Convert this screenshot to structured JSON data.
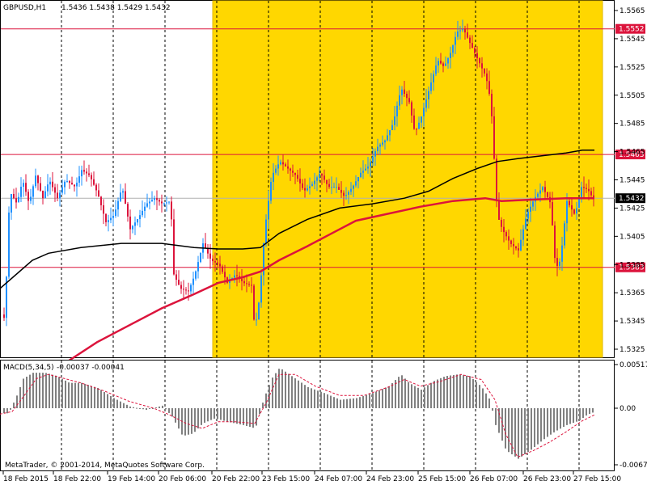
{
  "header": {
    "symbol": "GBPUSD,H1",
    "quote": "1.5436 1.5438 1.5429 1.5432"
  },
  "macd": {
    "label": "MACD(5,34,5)",
    "values": "-0.00037 -0.00041",
    "axis_labels": [
      "0.00517",
      "0.00",
      "-0.00671"
    ],
    "ylim": [
      -0.00671,
      0.00517
    ]
  },
  "footer": {
    "copyright": "MetaTrader, © 2001-2014, MetaQuotes Software Corp."
  },
  "colors": {
    "background": "#ffffff",
    "highlight": "#ffd700",
    "bull_candle": "#1e90ff",
    "bear_candle": "#dc143c",
    "ma_fast": "#dc143c",
    "ma_slow": "#000000",
    "level_line": "#dc143c",
    "macd_hist": "#808080",
    "macd_signal": "#dc143c"
  },
  "chart_data": {
    "type": "candlestick",
    "ylim": [
      1.532,
      1.5574
    ],
    "price_axis_labels": [
      "1.5565",
      "1.5545",
      "1.5525",
      "1.5505",
      "1.5485",
      "1.5465",
      "1.5445",
      "1.5425",
      "1.5405",
      "1.5385",
      "1.5365",
      "1.5345",
      "1.5325"
    ],
    "time_axis_labels": [
      "18 Feb 2015",
      "18 Feb 22:00",
      "19 Feb 14:00",
      "20 Feb 06:00",
      "20 Feb 22:00",
      "23 Feb 15:00",
      "24 Feb 07:00",
      "24 Feb 23:00",
      "25 Feb 15:00",
      "26 Feb 07:00",
      "26 Feb 23:00",
      "27 Feb 15:00"
    ],
    "levels": [
      {
        "label": "1.5552",
        "value": 1.5552
      },
      {
        "label": "1.5463",
        "value": 1.5463
      },
      {
        "label": "1.5383",
        "value": 1.5383
      }
    ],
    "current_price": {
      "label": "1.5432",
      "value": 1.5432
    },
    "highlight_range": [
      "20 Feb 22:00",
      "27 Feb 15:00"
    ],
    "close_path": [
      [
        0,
        1.5352
      ],
      [
        5,
        1.5346
      ],
      [
        11,
        1.5437
      ],
      [
        20,
        1.5428
      ],
      [
        27,
        1.5445
      ],
      [
        35,
        1.5428
      ],
      [
        43,
        1.5448
      ],
      [
        52,
        1.5432
      ],
      [
        60,
        1.5445
      ],
      [
        70,
        1.5432
      ],
      [
        80,
        1.5445
      ],
      [
        92,
        1.544
      ],
      [
        100,
        1.5452
      ],
      [
        110,
        1.5448
      ],
      [
        120,
        1.5435
      ],
      [
        130,
        1.5415
      ],
      [
        140,
        1.542
      ],
      [
        150,
        1.544
      ],
      [
        160,
        1.541
      ],
      [
        170,
        1.5418
      ],
      [
        180,
        1.5428
      ],
      [
        190,
        1.5432
      ],
      [
        200,
        1.5428
      ],
      [
        210,
        1.543
      ],
      [
        214,
        1.5378
      ],
      [
        222,
        1.5368
      ],
      [
        232,
        1.5366
      ],
      [
        240,
        1.5378
      ],
      [
        250,
        1.54
      ],
      [
        260,
        1.5388
      ],
      [
        270,
        1.5385
      ],
      [
        280,
        1.5372
      ],
      [
        290,
        1.5378
      ],
      [
        300,
        1.5372
      ],
      [
        310,
        1.537
      ],
      [
        314,
        1.5338
      ],
      [
        320,
        1.5362
      ],
      [
        326,
        1.5408
      ],
      [
        335,
        1.5448
      ],
      [
        345,
        1.5458
      ],
      [
        355,
        1.5453
      ],
      [
        365,
        1.5448
      ],
      [
        375,
        1.5437
      ],
      [
        385,
        1.5442
      ],
      [
        395,
        1.545
      ],
      [
        405,
        1.544
      ],
      [
        415,
        1.544
      ],
      [
        425,
        1.5433
      ],
      [
        435,
        1.544
      ],
      [
        445,
        1.545
      ],
      [
        455,
        1.5455
      ],
      [
        465,
        1.5468
      ],
      [
        475,
        1.5473
      ],
      [
        485,
        1.5485
      ],
      [
        495,
        1.551
      ],
      [
        505,
        1.55
      ],
      [
        512,
        1.5478
      ],
      [
        520,
        1.549
      ],
      [
        530,
        1.551
      ],
      [
        540,
        1.553
      ],
      [
        548,
        1.5525
      ],
      [
        556,
        1.5535
      ],
      [
        564,
        1.555
      ],
      [
        572,
        1.5552
      ],
      [
        580,
        1.5542
      ],
      [
        590,
        1.553
      ],
      [
        600,
        1.5518
      ],
      [
        606,
        1.55
      ],
      [
        610,
        1.546
      ],
      [
        614,
        1.542
      ],
      [
        620,
        1.541
      ],
      [
        630,
        1.54
      ],
      [
        640,
        1.5395
      ],
      [
        650,
        1.542
      ],
      [
        660,
        1.5432
      ],
      [
        670,
        1.544
      ],
      [
        680,
        1.5428
      ],
      [
        686,
        1.5382
      ],
      [
        692,
        1.5388
      ],
      [
        700,
        1.543
      ],
      [
        710,
        1.542
      ],
      [
        718,
        1.544
      ],
      [
        726,
        1.5438
      ],
      [
        732,
        1.5432
      ]
    ],
    "ma_slow": [
      [
        0,
        1.5368
      ],
      [
        20,
        1.5378
      ],
      [
        40,
        1.5388
      ],
      [
        60,
        1.5393
      ],
      [
        100,
        1.5397
      ],
      [
        150,
        1.54
      ],
      [
        200,
        1.54
      ],
      [
        240,
        1.5397
      ],
      [
        270,
        1.5396
      ],
      [
        300,
        1.5396
      ],
      [
        322,
        1.5397
      ],
      [
        345,
        1.5407
      ],
      [
        380,
        1.5417
      ],
      [
        420,
        1.5425
      ],
      [
        460,
        1.5428
      ],
      [
        500,
        1.5432
      ],
      [
        530,
        1.5437
      ],
      [
        560,
        1.5446
      ],
      [
        590,
        1.5453
      ],
      [
        615,
        1.5458
      ],
      [
        640,
        1.546
      ],
      [
        670,
        1.5462
      ],
      [
        700,
        1.5464
      ],
      [
        720,
        1.5466
      ],
      [
        735,
        1.5466
      ]
    ],
    "ma_fast": [
      [
        80,
        1.5315
      ],
      [
        120,
        1.533
      ],
      [
        160,
        1.5342
      ],
      [
        200,
        1.5354
      ],
      [
        240,
        1.5364
      ],
      [
        270,
        1.5372
      ],
      [
        300,
        1.5376
      ],
      [
        322,
        1.538
      ],
      [
        345,
        1.5388
      ],
      [
        380,
        1.5398
      ],
      [
        410,
        1.5407
      ],
      [
        440,
        1.5416
      ],
      [
        480,
        1.5421
      ],
      [
        520,
        1.5426
      ],
      [
        560,
        1.543
      ],
      [
        600,
        1.5432
      ],
      [
        620,
        1.543
      ],
      [
        660,
        1.5431
      ],
      [
        700,
        1.5432
      ],
      [
        735,
        1.5432
      ]
    ],
    "macd_hist": [
      [
        0,
        -0.0006
      ],
      [
        10,
        -0.0006
      ],
      [
        20,
        0.0015
      ],
      [
        28,
        0.0035
      ],
      [
        40,
        0.0042
      ],
      [
        55,
        0.0042
      ],
      [
        70,
        0.0038
      ],
      [
        85,
        0.003
      ],
      [
        100,
        0.003
      ],
      [
        120,
        0.0024
      ],
      [
        140,
        0.0012
      ],
      [
        160,
        0.0002
      ],
      [
        180,
        -0.0002
      ],
      [
        200,
        0.0003
      ],
      [
        212,
        -0.001
      ],
      [
        225,
        -0.0033
      ],
      [
        238,
        -0.003
      ],
      [
        250,
        -0.0018
      ],
      [
        265,
        -0.0012
      ],
      [
        280,
        -0.0016
      ],
      [
        300,
        -0.002
      ],
      [
        315,
        -0.0024
      ],
      [
        325,
        0.001
      ],
      [
        335,
        0.0035
      ],
      [
        345,
        0.0048
      ],
      [
        360,
        0.0038
      ],
      [
        380,
        0.0025
      ],
      [
        400,
        0.0018
      ],
      [
        420,
        0.001
      ],
      [
        440,
        0.0012
      ],
      [
        460,
        0.0018
      ],
      [
        480,
        0.0026
      ],
      [
        495,
        0.004
      ],
      [
        505,
        0.003
      ],
      [
        520,
        0.0022
      ],
      [
        535,
        0.0032
      ],
      [
        550,
        0.0038
      ],
      [
        565,
        0.004
      ],
      [
        580,
        0.0038
      ],
      [
        595,
        0.0025
      ],
      [
        605,
        0.001
      ],
      [
        612,
        -0.002
      ],
      [
        625,
        -0.005
      ],
      [
        640,
        -0.006
      ],
      [
        655,
        -0.005
      ],
      [
        670,
        -0.0038
      ],
      [
        685,
        -0.0028
      ],
      [
        700,
        -0.002
      ],
      [
        715,
        -0.0015
      ],
      [
        725,
        -0.0008
      ],
      [
        735,
        -0.0004
      ]
    ],
    "macd_signal": [
      [
        0,
        -0.0007
      ],
      [
        15,
        -0.0004
      ],
      [
        30,
        0.0015
      ],
      [
        45,
        0.0035
      ],
      [
        60,
        0.004
      ],
      [
        80,
        0.0035
      ],
      [
        100,
        0.003
      ],
      [
        130,
        0.002
      ],
      [
        160,
        0.0008
      ],
      [
        190,
        0.0
      ],
      [
        210,
        -0.0008
      ],
      [
        230,
        -0.0018
      ],
      [
        250,
        -0.0024
      ],
      [
        270,
        -0.0016
      ],
      [
        290,
        -0.0016
      ],
      [
        315,
        -0.0018
      ],
      [
        330,
        0.0008
      ],
      [
        345,
        0.004
      ],
      [
        365,
        0.004
      ],
      [
        390,
        0.0026
      ],
      [
        420,
        0.0015
      ],
      [
        450,
        0.0015
      ],
      [
        480,
        0.0025
      ],
      [
        500,
        0.0034
      ],
      [
        520,
        0.0026
      ],
      [
        545,
        0.0032
      ],
      [
        570,
        0.004
      ],
      [
        595,
        0.0034
      ],
      [
        612,
        0.001
      ],
      [
        625,
        -0.003
      ],
      [
        640,
        -0.0058
      ],
      [
        660,
        -0.005
      ],
      [
        680,
        -0.004
      ],
      [
        700,
        -0.0028
      ],
      [
        720,
        -0.0015
      ],
      [
        735,
        -0.0008
      ]
    ]
  }
}
